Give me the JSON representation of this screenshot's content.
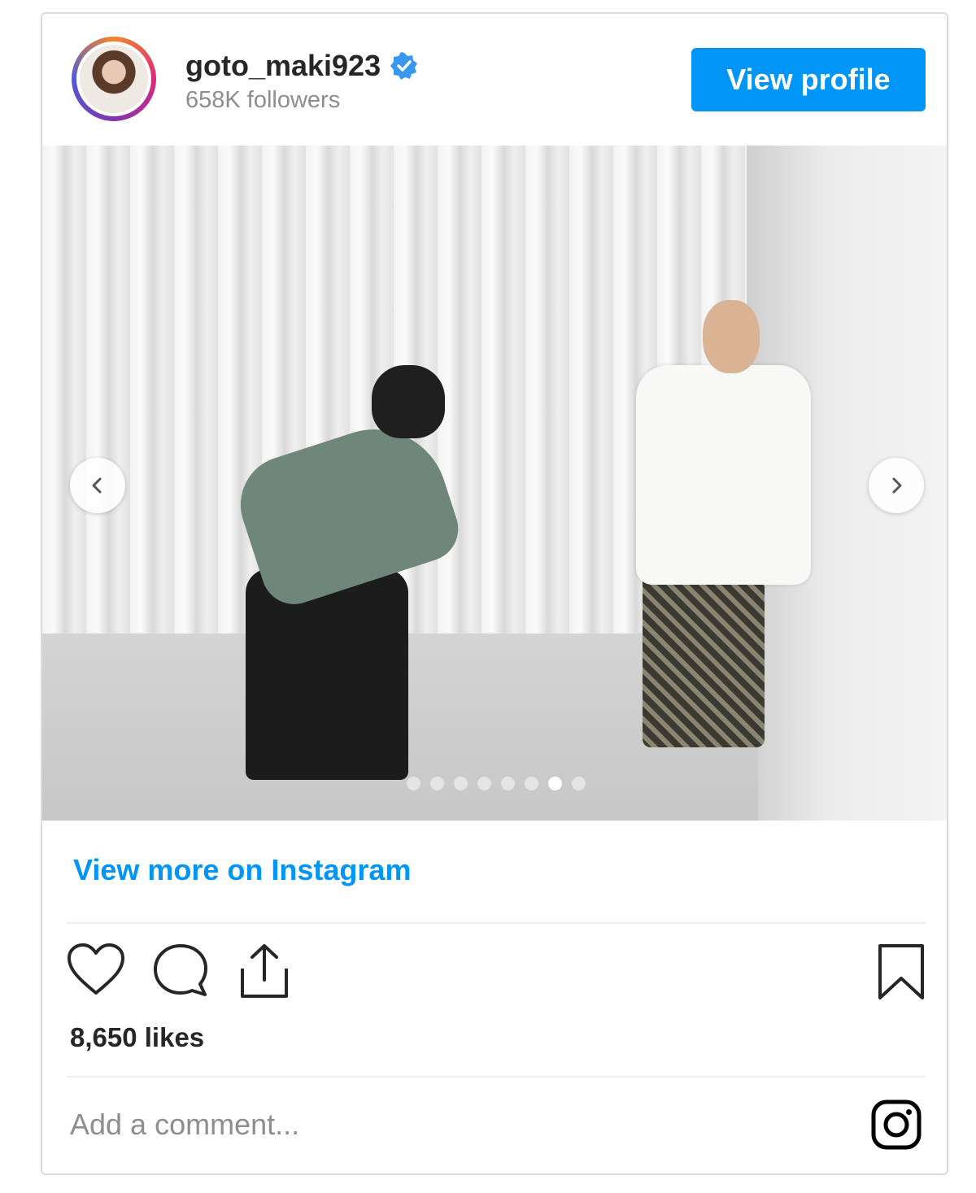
{
  "profile": {
    "username": "goto_maki923",
    "followers": "658K followers",
    "view_profile_label": "View profile"
  },
  "media": {
    "carousel_count": 8,
    "active_index": 7
  },
  "footer": {
    "view_more_label": "View more on Instagram",
    "likes": "8,650 likes",
    "comment_placeholder": "Add a comment..."
  },
  "colors": {
    "accent": "#0095f6",
    "text": "#262626",
    "muted": "#8e8e8e",
    "border": "#dbdbdb"
  },
  "icons": [
    "verified-badge-icon",
    "chevron-left-icon",
    "chevron-right-icon",
    "heart-icon",
    "comment-icon",
    "share-icon",
    "bookmark-icon",
    "instagram-logo-icon"
  ]
}
